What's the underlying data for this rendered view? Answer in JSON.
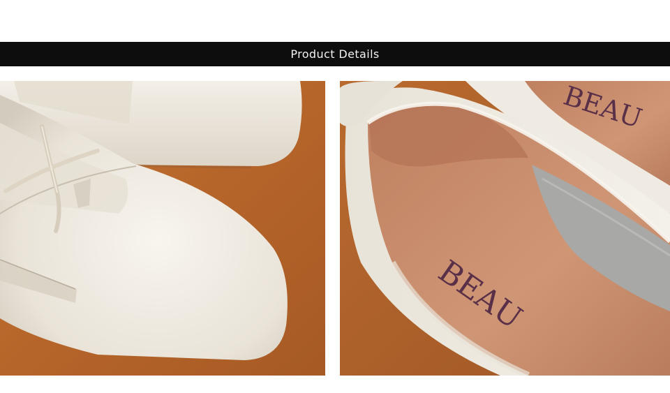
{
  "banner": {
    "title": "Product Details"
  },
  "photos": {
    "left": {
      "subject": "shoe-toe-and-laces-closeup"
    },
    "right": {
      "subject": "insole-closeup",
      "brand_top": "BEAU",
      "brand_insole": "BEAU"
    }
  },
  "colors": {
    "banner_bg": "#0d0d0d",
    "banner_text": "#f2f2f2",
    "leather": "#ece7de",
    "background_suede": "#b8692b",
    "insole": "#c98d6b",
    "brand_print": "#5a3049"
  }
}
